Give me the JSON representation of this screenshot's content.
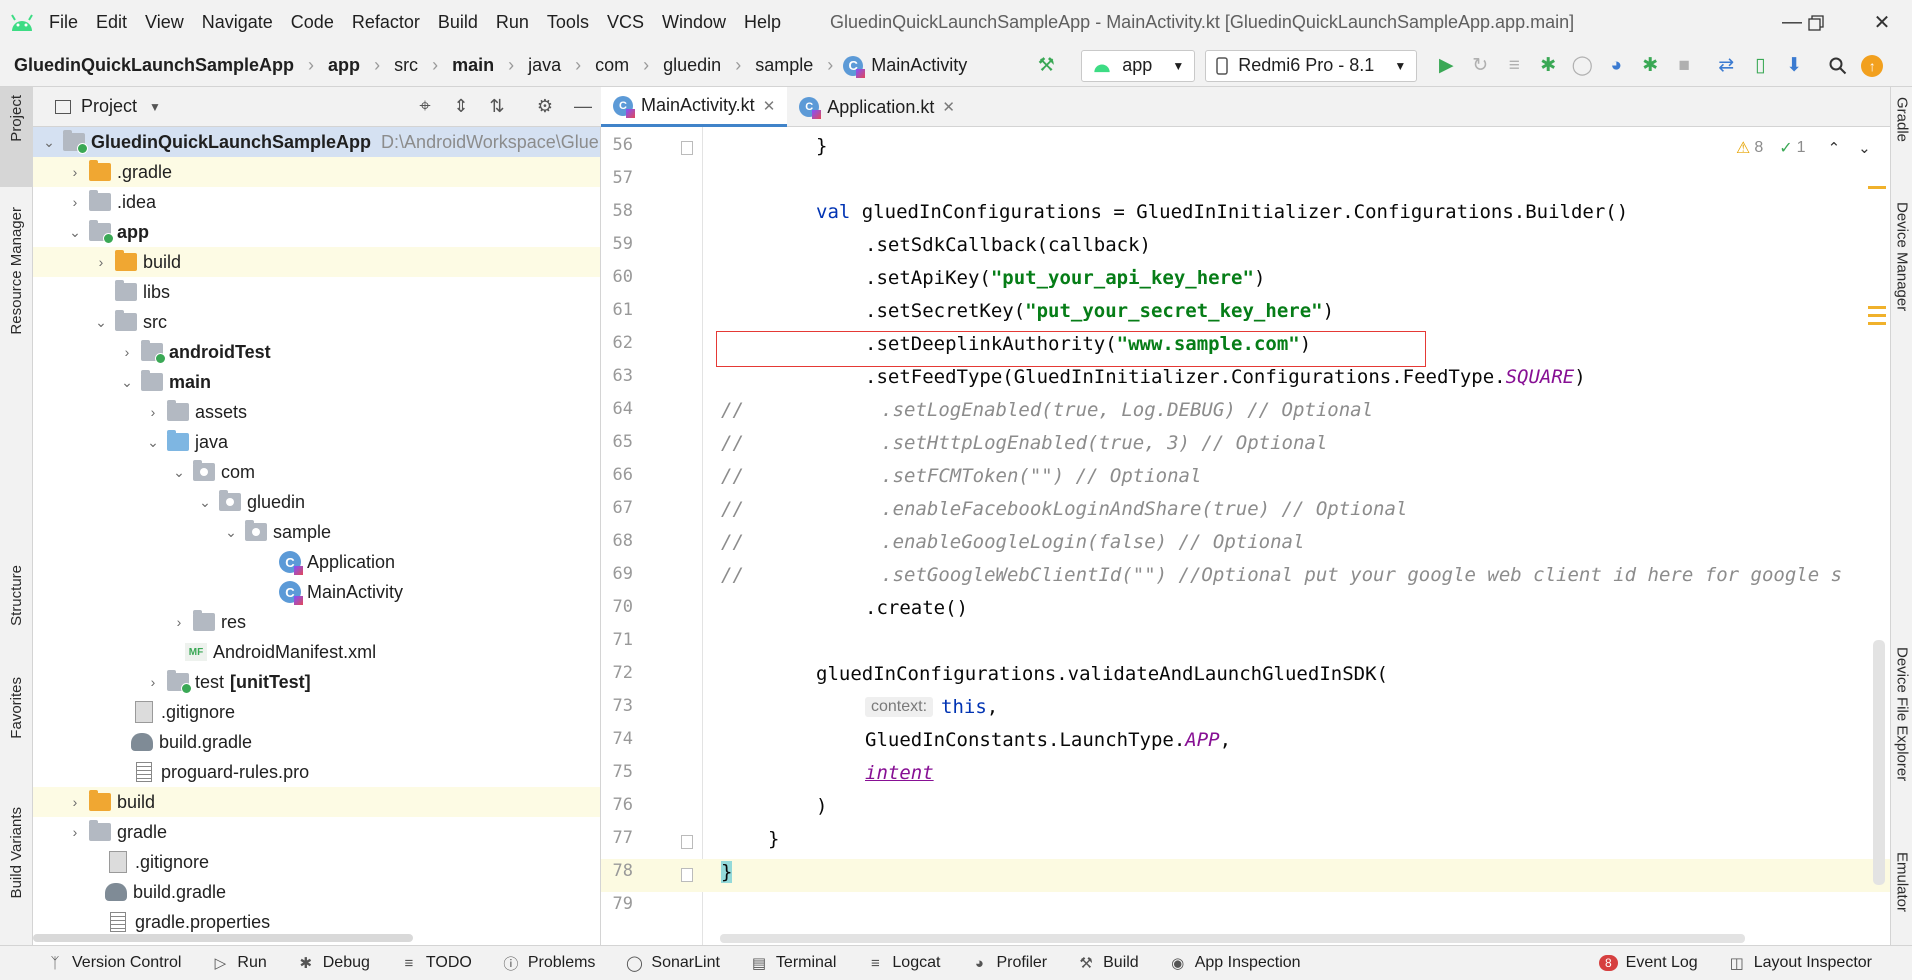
{
  "menubar": {
    "items": [
      "File",
      "Edit",
      "View",
      "Navigate",
      "Code",
      "Refactor",
      "Build",
      "Run",
      "Tools",
      "VCS",
      "Window",
      "Help"
    ],
    "window_title": "GluedinQuickLaunchSampleApp - MainActivity.kt [GluedinQuickLaunchSampleApp.app.main]"
  },
  "breadcrumb": [
    "GluedinQuickLaunchSampleApp",
    "app",
    "src",
    "main",
    "java",
    "com",
    "gluedin",
    "sample",
    "MainActivity"
  ],
  "toolbar": {
    "run_config": "app",
    "device": "Redmi6 Pro - 8.1"
  },
  "left_tool_windows": [
    "Project",
    "Resource Manager",
    "Structure",
    "Favorites",
    "Build Variants"
  ],
  "right_tool_windows": [
    "Gradle",
    "Device Manager",
    "Device File Explorer",
    "Emulator"
  ],
  "project_panel": {
    "title": "Project"
  },
  "tree": [
    {
      "label": "GluedinQuickLaunchSampleApp",
      "path": "D:\\AndroidWorkspace\\Glue"
    },
    {
      "label": ".gradle"
    },
    {
      "label": ".idea"
    },
    {
      "label": "app"
    },
    {
      "label": "build"
    },
    {
      "label": "libs"
    },
    {
      "label": "src"
    },
    {
      "label": "androidTest"
    },
    {
      "label": "main"
    },
    {
      "label": "assets"
    },
    {
      "label": "java"
    },
    {
      "label": "com"
    },
    {
      "label": "gluedin"
    },
    {
      "label": "sample"
    },
    {
      "label": "Application"
    },
    {
      "label": "MainActivity"
    },
    {
      "label": "res"
    },
    {
      "label": "AndroidManifest.xml"
    },
    {
      "label": "test",
      "suffix": "[unitTest]"
    },
    {
      "label": ".gitignore"
    },
    {
      "label": "build.gradle"
    },
    {
      "label": "proguard-rules.pro"
    },
    {
      "label": "build"
    },
    {
      "label": "gradle"
    },
    {
      "label": ".gitignore"
    },
    {
      "label": "build.gradle"
    },
    {
      "label": "gradle.properties"
    }
  ],
  "editor_tabs": [
    "MainActivity.kt",
    "Application.kt"
  ],
  "inspections": {
    "warnings": "8",
    "weak": "1"
  },
  "line_numbers": [
    "56",
    "57",
    "58",
    "59",
    "60",
    "61",
    "62",
    "63",
    "64",
    "65",
    "66",
    "67",
    "68",
    "69",
    "70",
    "71",
    "72",
    "73",
    "74",
    "75",
    "76",
    "77",
    "78",
    "79"
  ],
  "code": {
    "l56": "}",
    "l58_kw": "val",
    "l58_rest": " gluedInConfigurations = GluedInInitializer.Configurations.Builder()",
    "l59": ".setSdkCallback(callback)",
    "l60_a": ".setApiKey(",
    "l60_str": "\"put_your_api_key_here\"",
    "l60_b": ")",
    "l61_a": ".setSecretKey(",
    "l61_str": "\"put_your_secret_key_here\"",
    "l61_b": ")",
    "l62_a": ".setDeeplinkAuthority(",
    "l62_str": "\"www.sample.com\"",
    "l62_b": ")",
    "l63_a": ".setFeedType(GluedInInitializer.Configurations.FeedType.",
    "l63_it": "SQUARE",
    "l63_b": ")",
    "l64": "//            .setLogEnabled(true, Log.DEBUG) // Optional",
    "l65": "//            .setHttpLogEnabled(true, 3) // Optional",
    "l66": "//            .setFCMToken(\"\") // Optional",
    "l67": "//            .enableFacebookLoginAndShare(true) // Optional",
    "l68": "//            .enableGoogleLogin(false) // Optional",
    "l69": "//            .setGoogleWebClientId(\"\") //Optional put your google web client id here for google s",
    "l70": ".create()",
    "l72": "gluedInConfigurations.validateAndLaunchGluedInSDK(",
    "l73_hint": "context:",
    "l73_kw": "this",
    "l73_b": ",",
    "l74_a": "GluedInConstants.LaunchType.",
    "l74_it": "APP",
    "l74_b": ",",
    "l75": "intent",
    "l76": ")",
    "l77": "}",
    "l78": "}"
  },
  "statusbar": {
    "items": [
      "Version Control",
      "Run",
      "Debug",
      "TODO",
      "Problems",
      "SonarLint",
      "Terminal",
      "Logcat",
      "Profiler",
      "Build",
      "App Inspection"
    ],
    "event_log_count": "8",
    "event_log": "Event Log",
    "layout_inspector": "Layout Inspector"
  },
  "colors": {
    "accent": "#4083c9",
    "highlight_box": "#e53935",
    "keyword": "#0033b3",
    "string": "#067d17"
  }
}
